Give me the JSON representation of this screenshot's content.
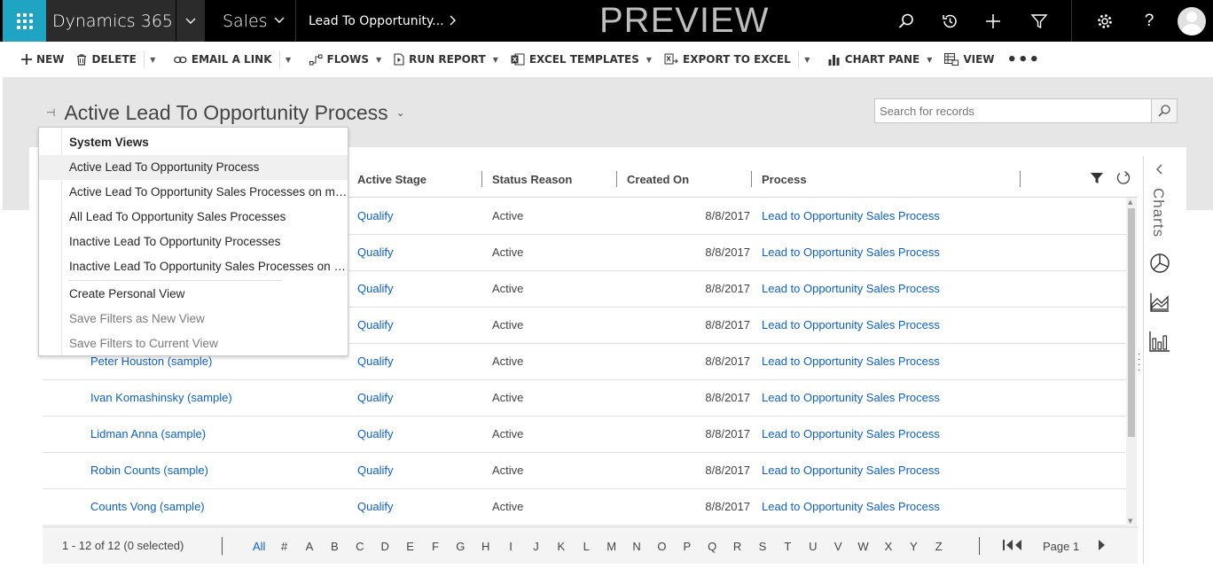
{
  "topbar": {
    "app_name": "Dynamics 365",
    "area": "Sales",
    "breadcrumb": "Lead To Opportunity...",
    "preview_label": "PREVIEW"
  },
  "commands": [
    {
      "label": "NEW",
      "icon": "plus-icon"
    },
    {
      "label": "DELETE",
      "icon": "trash-icon"
    },
    {
      "label": "EMAIL A LINK",
      "icon": "link-icon"
    },
    {
      "label": "FLOWS",
      "icon": "flow-icon"
    },
    {
      "label": "RUN REPORT",
      "icon": "report-icon"
    },
    {
      "label": "EXCEL TEMPLATES",
      "icon": "excel-icon"
    },
    {
      "label": "EXPORT TO EXCEL",
      "icon": "export-excel-icon"
    },
    {
      "label": "CHART PANE",
      "icon": "chart-icon"
    },
    {
      "label": "VIEW",
      "icon": "view-icon"
    }
  ],
  "view": {
    "title": "Active Lead To Opportunity Process"
  },
  "search": {
    "placeholder": "Search for records"
  },
  "grid": {
    "columns": [
      "Active Stage",
      "Status Reason",
      "Created On",
      "Process"
    ],
    "rows": [
      {
        "name": "",
        "stage": "Qualify",
        "status": "Active",
        "created": "8/8/2017",
        "process": "Lead to Opportunity Sales Process"
      },
      {
        "name": "",
        "stage": "Qualify",
        "status": "Active",
        "created": "8/8/2017",
        "process": "Lead to Opportunity Sales Process"
      },
      {
        "name": "",
        "stage": "Qualify",
        "status": "Active",
        "created": "8/8/2017",
        "process": "Lead to Opportunity Sales Process"
      },
      {
        "name": "",
        "stage": "Qualify",
        "status": "Active",
        "created": "8/8/2017",
        "process": "Lead to Opportunity Sales Process"
      },
      {
        "name": "Peter Houston (sample)",
        "stage": "Qualify",
        "status": "Active",
        "created": "8/8/2017",
        "process": "Lead to Opportunity Sales Process"
      },
      {
        "name": "Ivan Komashinsky (sample)",
        "stage": "Qualify",
        "status": "Active",
        "created": "8/8/2017",
        "process": "Lead to Opportunity Sales Process"
      },
      {
        "name": "Lidman Anna (sample)",
        "stage": "Qualify",
        "status": "Active",
        "created": "8/8/2017",
        "process": "Lead to Opportunity Sales Process"
      },
      {
        "name": "Robin Counts (sample)",
        "stage": "Qualify",
        "status": "Active",
        "created": "8/8/2017",
        "process": "Lead to Opportunity Sales Process"
      },
      {
        "name": "Counts Vong (sample)",
        "stage": "Qualify",
        "status": "Active",
        "created": "8/8/2017",
        "process": "Lead to Opportunity Sales Process"
      }
    ]
  },
  "footer": {
    "count": "1 - 12 of 12 (0 selected)",
    "letters": [
      "All",
      "#",
      "A",
      "B",
      "C",
      "D",
      "E",
      "F",
      "G",
      "H",
      "I",
      "J",
      "K",
      "L",
      "M",
      "N",
      "O",
      "P",
      "Q",
      "R",
      "S",
      "T",
      "U",
      "V",
      "W",
      "X",
      "Y",
      "Z"
    ],
    "page": "Page 1"
  },
  "charts_panel": {
    "label": "Charts"
  },
  "dropdown": {
    "header": "System Views",
    "items": [
      {
        "label": "Active Lead To Opportunity Process",
        "state": "hover"
      },
      {
        "label": "Active Lead To Opportunity Sales Processes on my Team",
        "state": "normal"
      },
      {
        "label": "All Lead To Opportunity Sales Processes",
        "state": "normal"
      },
      {
        "label": "Inactive Lead To Opportunity Processes",
        "state": "normal"
      },
      {
        "label": "Inactive Lead To Opportunity Sales Processes on my Team",
        "state": "normal"
      },
      {
        "label": "Create Personal View",
        "state": "normal"
      },
      {
        "label": "Save Filters as New View",
        "state": "disabled"
      },
      {
        "label": "Save Filters to Current View",
        "state": "disabled"
      }
    ]
  },
  "colors": {
    "accent": "#1fa4c4",
    "link": "#1160b7",
    "topbar": "#000000"
  }
}
